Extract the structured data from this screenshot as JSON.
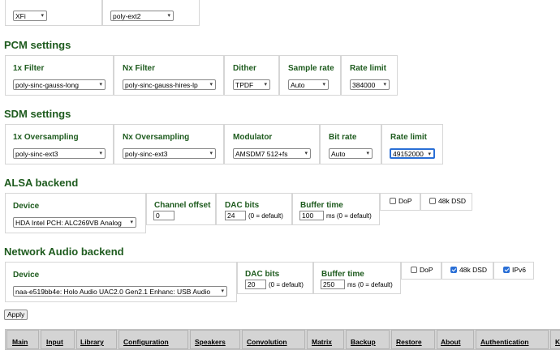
{
  "top": {
    "select1": "XFi",
    "select2": "poly-ext2"
  },
  "pcm": {
    "title": "PCM settings",
    "filter1x_label": "1x Filter",
    "filter1x_value": "poly-sinc-gauss-long",
    "filterNx_label": "Nx Filter",
    "filterNx_value": "poly-sinc-gauss-hires-lp",
    "dither_label": "Dither",
    "dither_value": "TPDF",
    "rate_label": "Sample rate",
    "rate_value": "Auto",
    "limit_label": "Rate limit",
    "limit_value": "384000"
  },
  "sdm": {
    "title": "SDM settings",
    "os1x_label": "1x Oversampling",
    "os1x_value": "poly-sinc-ext3",
    "osNx_label": "Nx Oversampling",
    "osNx_value": "poly-sinc-ext3",
    "mod_label": "Modulator",
    "mod_value": "AMSDM7 512+fs",
    "bitrate_label": "Bit rate",
    "bitrate_value": "Auto",
    "limit_label": "Rate limit",
    "limit_value": "49152000"
  },
  "alsa": {
    "title": "ALSA backend",
    "device_label": "Device",
    "device_value": "HDA Intel PCH: ALC269VB Analog",
    "offset_label": "Channel offset",
    "offset_value": "0",
    "dacbits_label": "DAC bits",
    "dacbits_value": "24",
    "dacbits_hint": "(0 = default)",
    "buffer_label": "Buffer time",
    "buffer_value": "100",
    "buffer_hint": "ms (0 = default)",
    "dop_label": "DoP",
    "dop_checked": false,
    "dsd48_label": "48k DSD",
    "dsd48_checked": false
  },
  "naa": {
    "title": "Network Audio backend",
    "device_label": "Device",
    "device_value": "naa-e519bb4e: Holo Audio UAC2.0 Gen2.1 Enhanc: USB Audio",
    "dacbits_label": "DAC bits",
    "dacbits_value": "20",
    "dacbits_hint": "(0 = default)",
    "buffer_label": "Buffer time",
    "buffer_value": "250",
    "buffer_hint": "ms (0 = default)",
    "dop_label": "DoP",
    "dop_checked": false,
    "dsd48_label": "48k DSD",
    "dsd48_checked": true,
    "ipv6_label": "IPv6",
    "ipv6_checked": true
  },
  "apply_label": "Apply",
  "nav": {
    "main": "Main",
    "input": "Input",
    "library": "Library",
    "configuration": "Configuration",
    "speakers": "Speakers",
    "convolution": "Convolution",
    "matrix": "Matrix",
    "backup": "Backup",
    "restore": "Restore",
    "about": "About",
    "authentication": "Authentication",
    "more": "K"
  },
  "colors": {
    "heading": "#1e5b1e",
    "checkbox_on": "#2a6fd6",
    "navbar": "#d4d4d4"
  }
}
